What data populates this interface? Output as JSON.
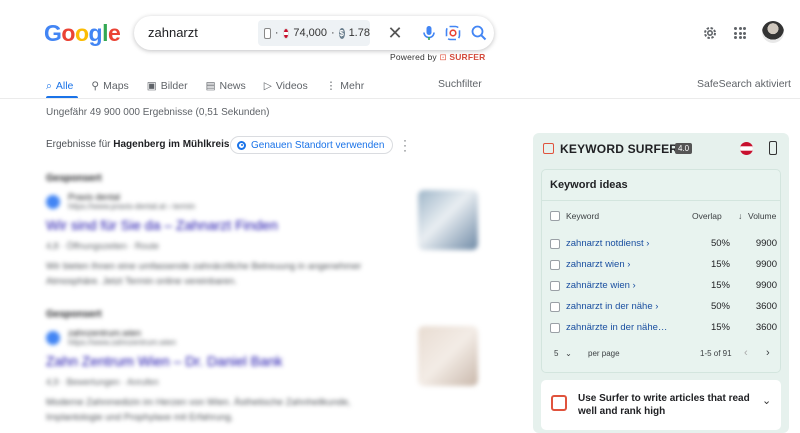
{
  "logo": [
    "G",
    "o",
    "o",
    "g",
    "l",
    "e"
  ],
  "search": {
    "query": "zahnarzt",
    "metric_count": "74,000",
    "metric_cpc": "1.78"
  },
  "powered_by": {
    "prefix": "Powered by",
    "brand": "SURFER"
  },
  "tabs": [
    {
      "label": "Alle",
      "icon": "search-icon",
      "active": true
    },
    {
      "label": "Maps",
      "icon": "map-pin-icon"
    },
    {
      "label": "Bilder",
      "icon": "image-icon"
    },
    {
      "label": "News",
      "icon": "news-icon"
    },
    {
      "label": "Videos",
      "icon": "play-icon"
    },
    {
      "label": "Mehr",
      "icon": "more-vert-icon"
    }
  ],
  "suchfilter": "Suchfilter",
  "safesearch": "SafeSearch aktiviert",
  "stats": "Ungefähr 49 900 000 Ergebnisse (0,51 Sekunden)",
  "location": {
    "prefix": "Ergebnisse für",
    "place": "Hagenberg im Mühlkreis",
    "button": "Genauen Standort verwenden"
  },
  "results": [
    {
      "ad": "Gesponsert",
      "site": "Praxis dental",
      "url": "https://www.praxis-dental.at › termin",
      "title": "Wir sind für Sie da – Zahnarzt Finden",
      "meta": "4,8 · Öffnungszeiten · Route",
      "desc": "Wir bieten Ihnen eine umfassende zahnärztliche Betreuung in angenehmer Atmosphäre. Jetzt Termin online vereinbaren."
    },
    {
      "ad": "Gesponsert",
      "site": "zahnzentrum.wien",
      "url": "https://www.zahnzentrum.wien",
      "title": "Zahn Zentrum Wien – Dr. Daniel Bank",
      "meta": "4,9 · Bewertungen · Anrufen",
      "desc": "Moderne Zahnmedizin im Herzen von Wien. Ästhetische Zahnheilkunde, Implantologie und Prophylaxe mit Erfahrung."
    }
  ],
  "keyword_surfer": {
    "title": "KEYWORD SURFER",
    "version": "4.0",
    "ideas_title": "Keyword ideas",
    "columns": {
      "keyword": "Keyword",
      "overlap": "Overlap",
      "volume": "Volume"
    },
    "rows": [
      {
        "keyword": "zahnarzt notdienst",
        "overlap": "50%",
        "volume": "9900"
      },
      {
        "keyword": "zahnarzt wien",
        "overlap": "15%",
        "volume": "9900"
      },
      {
        "keyword": "zahnärzte wien",
        "overlap": "15%",
        "volume": "9900"
      },
      {
        "keyword": "zahnarzt in der nähe",
        "overlap": "50%",
        "volume": "3600"
      },
      {
        "keyword": "zahnärzte in der nähe…",
        "overlap": "15%",
        "volume": "3600"
      }
    ],
    "per_page_value": "5",
    "per_page_label": "per page",
    "pagination": "1-5 of 91",
    "cta": "Use Surfer to write articles that read well and rank high"
  },
  "colors": {
    "link": "#1a73e8",
    "surfer_bg": "#e6f1ed",
    "surfer_accent": "#e0533d"
  }
}
